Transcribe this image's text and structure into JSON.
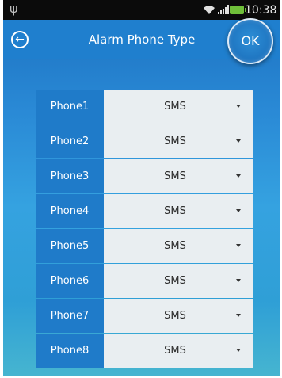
{
  "status_bar": {
    "time": "10:38",
    "battery_text": ""
  },
  "header": {
    "title": "Alarm Phone Type",
    "ok_label": "OK"
  },
  "phones": [
    {
      "label": "Phone1",
      "value": "SMS"
    },
    {
      "label": "Phone2",
      "value": "SMS"
    },
    {
      "label": "Phone3",
      "value": "SMS"
    },
    {
      "label": "Phone4",
      "value": "SMS"
    },
    {
      "label": "Phone5",
      "value": "SMS"
    },
    {
      "label": "Phone6",
      "value": "SMS"
    },
    {
      "label": "Phone7",
      "value": "SMS"
    },
    {
      "label": "Phone8",
      "value": "SMS"
    }
  ],
  "icons": {
    "usb": "usb-icon",
    "wifi": "wifi-icon",
    "signal": "signal-icon",
    "battery": "battery-icon",
    "back": "back-arrow-icon",
    "dropdown": "caret-down-icon"
  },
  "colors": {
    "header": "#1f7fce",
    "label_bg": "#1f7bc9",
    "select_bg": "#e9eef1"
  }
}
